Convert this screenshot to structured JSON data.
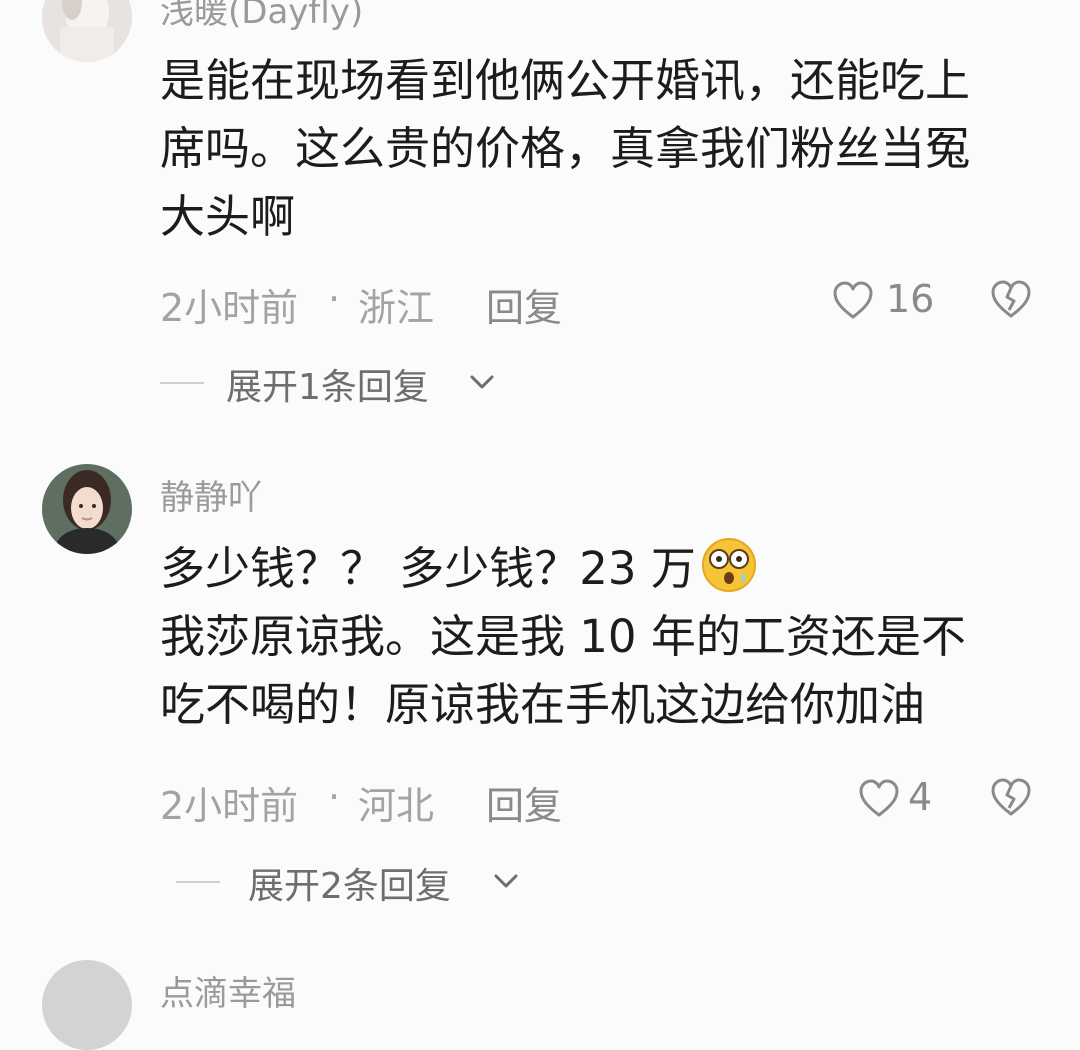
{
  "comments": [
    {
      "username": "浅暖(Dayfly)",
      "lines": [
        "是能在现场看到他俩公开婚讯，还能吃上",
        "席吗。这么贵的价格，真拿我们粉丝当冤",
        "大头啊"
      ],
      "time": "2小时前",
      "separator": "·",
      "region": "浙江",
      "reply_label": "回复",
      "like_count": "16",
      "expand_label": "展开1条回复"
    },
    {
      "username": "静静吖",
      "lines": [
        "多少钱？？ 多少钱？23 万",
        "我莎原谅我。这是我 10 年的工资还是不",
        "吃不喝的！原谅我在手机这边给你加油"
      ],
      "emoji": "astonished-face-emoji",
      "time": "2小时前",
      "separator": "·",
      "region": "河北",
      "reply_label": "回复",
      "like_count": "4",
      "expand_label": "展开2条回复"
    },
    {
      "username": "点滴幸福"
    }
  ],
  "icons": {
    "like": "heart-outline-icon",
    "dislike": "broken-heart-icon",
    "expand": "chevron-down-icon"
  }
}
